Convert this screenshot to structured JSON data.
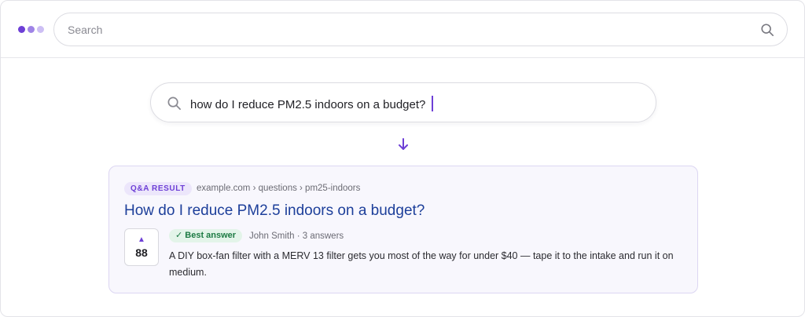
{
  "colors": {
    "accent": "#6d3fd6",
    "logo_dots": [
      "#6d3fd6",
      "#9f84e6",
      "#cdbff4"
    ],
    "link": "#1d3f9a",
    "best_answer_bg": "#e3f4e9",
    "best_answer_fg": "#1c7a43",
    "card_bg": "#f8f7fd"
  },
  "header": {
    "logo_icon": "three-dots-logo",
    "search": {
      "placeholder": "Search",
      "value": "",
      "icon": "search-icon"
    }
  },
  "query": {
    "text": "how do I reduce PM2.5 indoors on a budget?",
    "icon": "search-icon"
  },
  "flow_arrow_icon": "arrow-down-icon",
  "result": {
    "tag": "Q&A RESULT",
    "breadcrumb": "example.com › questions › pm25-indoors",
    "title": "How do I reduce PM2.5 indoors on a budget?",
    "votes": {
      "arrow": "▲",
      "count": "88"
    },
    "best_answer_label": "✓ Best answer",
    "meta": "John Smith · 3 answers",
    "answer": "A DIY box-fan filter with a MERV 13 filter gets you most of the way for under $40 — tape it to the intake and run it on medium."
  }
}
